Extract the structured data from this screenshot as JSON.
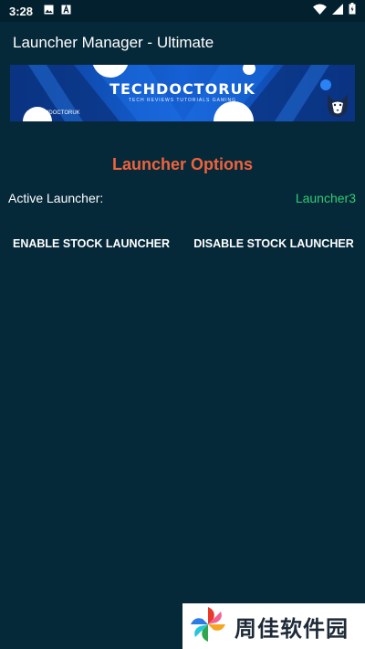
{
  "status_bar": {
    "time": "3:28",
    "icons_left": [
      "image-icon",
      "font-icon"
    ],
    "icons_right": [
      "wifi-icon",
      "signal-icon",
      "battery-icon"
    ]
  },
  "app_bar": {
    "title": "Launcher Manager - Ultimate"
  },
  "banner": {
    "title": "TECHDOCTORUK",
    "subtitle": "TECH REVIEWS   TUTORIALS   GAMING",
    "handle": "@TECHDOCTORUK"
  },
  "launcher_options": {
    "title": "Launcher Options",
    "active_label": "Active Launcher:",
    "active_value": "Launcher3",
    "enable_button": "ENABLE STOCK LAUNCHER",
    "disable_button": "DISABLE STOCK LAUNCHER"
  },
  "watermark": {
    "text": "周佳软件园"
  },
  "colors": {
    "background": "#06293a",
    "status_bar": "#03202e",
    "section_title": "#f0633b",
    "active_value": "#2fcc71",
    "banner_blue": "#0d4aa8"
  }
}
